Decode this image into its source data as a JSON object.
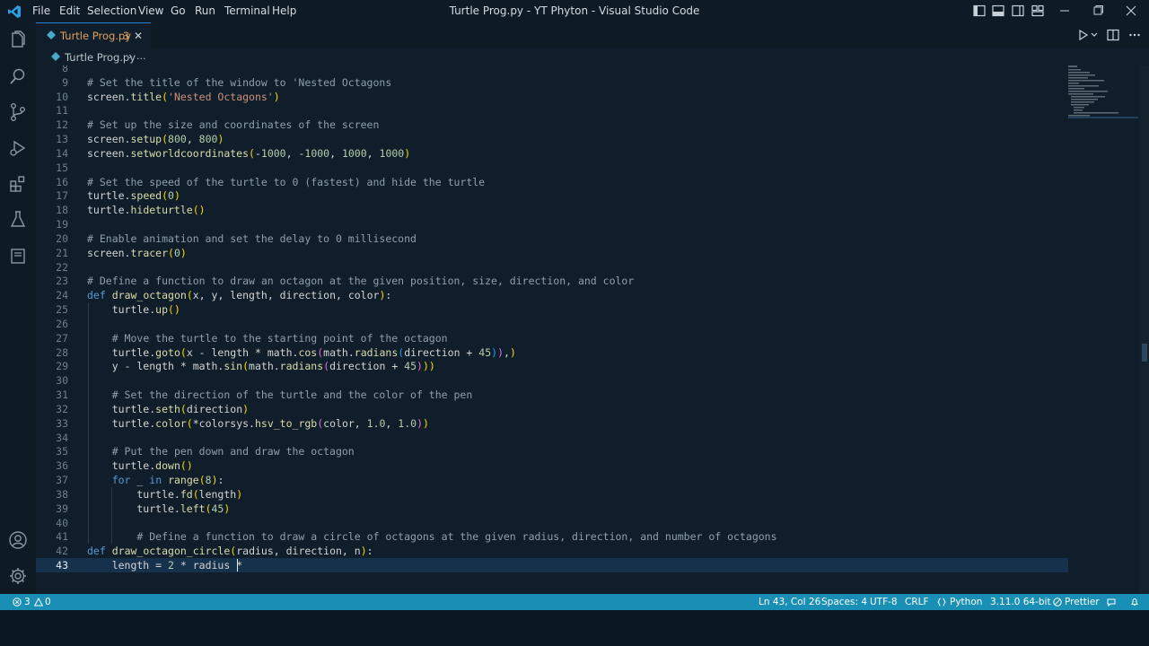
{
  "titlebar": {
    "menu": [
      "File",
      "Edit",
      "Selection",
      "View",
      "Go",
      "Run",
      "Terminal",
      "Help"
    ],
    "window_title": "Turtle Prog.py - YT Phyton - Visual Studio Code"
  },
  "tab": {
    "label": "Turtle Prog.py",
    "problem_count": "3",
    "close": "✕"
  },
  "breadcrumb": {
    "file": "Turtle Prog.py",
    "separator": "›",
    "more": "..."
  },
  "editor": {
    "current_line": 43,
    "lines": [
      {
        "num": "8",
        "text": ""
      },
      {
        "num": "9",
        "text": "# Set the title of the window to 'Nested Octagons"
      },
      {
        "num": "10",
        "text": "screen.title('Nested Octagons')"
      },
      {
        "num": "11",
        "text": ""
      },
      {
        "num": "12",
        "text": "# Set up the size and coordinates of the screen"
      },
      {
        "num": "13",
        "text": "screen.setup(800, 800)"
      },
      {
        "num": "14",
        "text": "screen.setworldcoordinates(-1000, -1000, 1000, 1000)"
      },
      {
        "num": "15",
        "text": ""
      },
      {
        "num": "16",
        "text": "# Set the speed of the turtle to 0 (fastest) and hide the turtle"
      },
      {
        "num": "17",
        "text": "turtle.speed(0)"
      },
      {
        "num": "18",
        "text": "turtle.hideturtle()"
      },
      {
        "num": "19",
        "text": ""
      },
      {
        "num": "20",
        "text": "# Enable animation and set the delay to 0 millisecond"
      },
      {
        "num": "21",
        "text": "screen.tracer(0)"
      },
      {
        "num": "22",
        "text": ""
      },
      {
        "num": "23",
        "text": "# Define a function to draw an octagon at the given position, size, direction, and color"
      },
      {
        "num": "24",
        "text": "def draw_octagon(x, y, length, direction, color):"
      },
      {
        "num": "25",
        "text": "    turtle.up()"
      },
      {
        "num": "26",
        "text": ""
      },
      {
        "num": "27",
        "text": "    # Move the turtle to the starting point of the octagon"
      },
      {
        "num": "28",
        "text": "    turtle.goto(x - length * math.cos(math.radians(direction + 45)),)"
      },
      {
        "num": "29",
        "text": "    y - length * math.sin(math.radians(direction + 45)))"
      },
      {
        "num": "30",
        "text": ""
      },
      {
        "num": "31",
        "text": "    # Set the direction of the turtle and the color of the pen"
      },
      {
        "num": "32",
        "text": "    turtle.seth(direction)"
      },
      {
        "num": "33",
        "text": "    turtle.color(*colorsys.hsv_to_rgb(color, 1.0, 1.0))"
      },
      {
        "num": "34",
        "text": ""
      },
      {
        "num": "35",
        "text": "    # Put the pen down and draw the octagon"
      },
      {
        "num": "36",
        "text": "    turtle.down()"
      },
      {
        "num": "37",
        "text": "    for _ in range(8):"
      },
      {
        "num": "38",
        "text": "        turtle.fd(length)"
      },
      {
        "num": "39",
        "text": "        turtle.left(45)"
      },
      {
        "num": "40",
        "text": ""
      },
      {
        "num": "41",
        "text": "        # Define a function to draw a circle of octagons at the given radius, direction, and number of octagons"
      },
      {
        "num": "42",
        "text": "def draw_octagon_circle(radius, direction, n):"
      },
      {
        "num": "43",
        "text": "    length = 2 * radius * "
      }
    ]
  },
  "statusbar": {
    "errors": "3",
    "warnings": "0",
    "position": "Ln 43, Col 26",
    "spaces": "Spaces: 4",
    "encoding": "UTF-8",
    "eol": "CRLF",
    "language": "Python",
    "interpreter": "3.11.0 64-bit",
    "formatter": "Prettier"
  },
  "colors": {
    "accent": "#1a8fb5",
    "background": "#0f1e2a",
    "tab_modified": "#e2a15f"
  }
}
